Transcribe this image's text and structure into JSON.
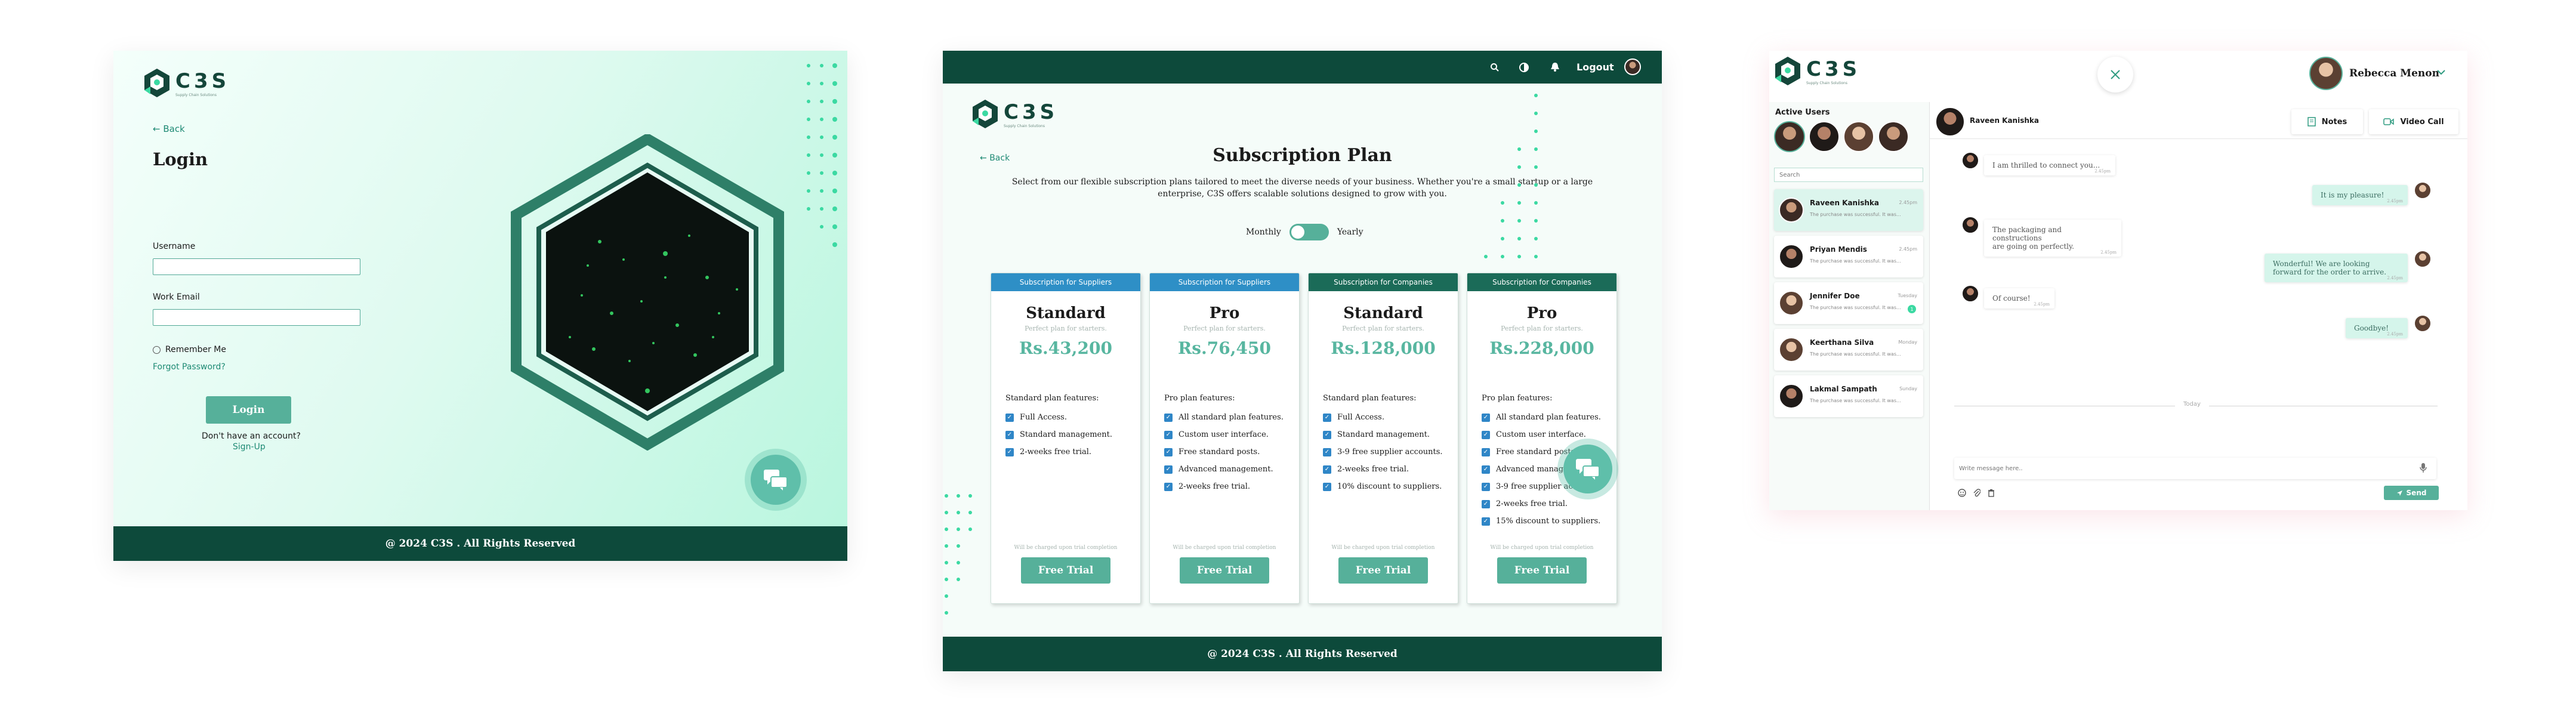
{
  "brand": {
    "name": "C3S",
    "tagline": "Supply Chain Solutions"
  },
  "login": {
    "back": "Back",
    "title": "Login",
    "username_label": "Username",
    "email_label": "Work Email",
    "remember": "Remember Me",
    "forgot": "Forgot Password?",
    "login_button": "Login",
    "no_account": "Don't have an account?",
    "signup": "Sign-Up",
    "footer": "@ 2024 C3S . All Rights Reserved"
  },
  "subscription": {
    "topbar": {
      "logout": "Logout"
    },
    "back": "Back",
    "title": "Subscription Plan",
    "description_line1": "Select from our flexible subscription plans tailored to meet the diverse needs of your business. Whether you're a small startup or a large",
    "description_line2": "enterprise, C3S offers scalable solutions designed to grow with you.",
    "toggle_monthly": "Monthly",
    "toggle_yearly": "Yearly",
    "plans": [
      {
        "header": "Subscription for Suppliers",
        "name": "Standard",
        "subtitle": "Perfect plan for starters.",
        "price": "Rs.43,200",
        "features_title": "Standard plan features:",
        "features": [
          "Full Access.",
          "Standard management.",
          "2-weeks free trial."
        ],
        "note": "Will be charged upon trial completion",
        "button": "Free Trial",
        "color": "#2e8fc6"
      },
      {
        "header": "Subscription for Suppliers",
        "name": "Pro",
        "subtitle": "Perfect plan for starters.",
        "price": "Rs.76,450",
        "features_title": "Pro plan features:",
        "features": [
          "All standard plan features.",
          "Custom user interface.",
          "Free standard posts.",
          "Advanced management.",
          "2-weeks free trial."
        ],
        "note": "Will be charged upon trial completion",
        "button": "Free Trial",
        "color": "#2e8fc6"
      },
      {
        "header": "Subscription for Companies",
        "name": "Standard",
        "subtitle": "Perfect plan for starters.",
        "price": "Rs.128,000",
        "features_title": "Standard plan features:",
        "features": [
          "Full Access.",
          "Standard management.",
          "3-9 free supplier accounts.",
          "2-weeks free trial.",
          "10% discount to suppliers."
        ],
        "note": "Will be charged upon trial completion",
        "button": "Free Trial",
        "color": "#1b6b58"
      },
      {
        "header": "Subscription for Companies",
        "name": "Pro",
        "subtitle": "Perfect plan for starters.",
        "price": "Rs.228,000",
        "features_title": "Pro plan features:",
        "features": [
          "All standard plan features.",
          "Custom user interface.",
          "Free standard posts.",
          "Advanced management.",
          "3-9 free supplier accounts.",
          "2-weeks free trial.",
          "15% discount to suppliers."
        ],
        "note": "Will be charged upon trial completion",
        "button": "Free Trial",
        "color": "#1b6b58"
      }
    ],
    "footer": "@ 2024 C3S . All Rights Reserved"
  },
  "chat": {
    "user_name": "Rebecca Menon",
    "active_users_title": "Active Users",
    "search_placeholder": "Search",
    "current_contact": "Raveen Kanishka",
    "notes_button": "Notes",
    "video_button": "Video Call",
    "conversations": [
      {
        "name": "Raveen Kanishka",
        "preview": "The purchase was successful. It was...",
        "time": "2.45pm"
      },
      {
        "name": "Priyan Mendis",
        "preview": "The purchase was successful. It was...",
        "time": "2.45pm"
      },
      {
        "name": "Jennifer Doe",
        "preview": "The purchase was successful. It was...",
        "time": "Tuesday",
        "unread": "1"
      },
      {
        "name": "Keerthana Silva",
        "preview": "The purchase was successful. It was...",
        "time": "Monday"
      },
      {
        "name": "Lakmal Sampath",
        "preview": "The purchase was successful. It was...",
        "time": "Sunday"
      }
    ],
    "messages": [
      {
        "text": "I am thrilled to connect you...",
        "time": "2.45pm",
        "dir": "in"
      },
      {
        "text": "It is my pleasure!",
        "time": "2.45pm",
        "dir": "out"
      },
      {
        "text1": "The packaging and constructions",
        "text2": "are going on perfectly.",
        "time": "2.45pm",
        "dir": "in"
      },
      {
        "text1": "Wonderful! We are looking",
        "text2": "forward for the order to arrive.",
        "time": "2.45pm",
        "dir": "out"
      },
      {
        "text": "Of course!",
        "time": "2.45pm",
        "dir": "in"
      },
      {
        "text": "Goodbye!",
        "time": "2.45pm",
        "dir": "out"
      }
    ],
    "divider": "Today",
    "input_placeholder": "Write message here..",
    "send_button": "Send"
  },
  "colors": {
    "primary": "#0d4a3b",
    "accent": "#56b09a",
    "mint": "#3bd9a2"
  }
}
